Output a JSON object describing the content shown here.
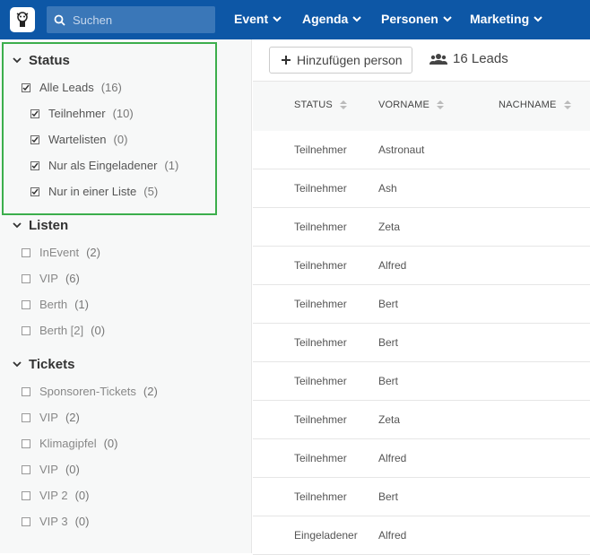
{
  "header": {
    "search_placeholder": "Suchen",
    "nav": [
      {
        "label": "Event"
      },
      {
        "label": "Agenda"
      },
      {
        "label": "Personen"
      },
      {
        "label": "Marketing"
      }
    ],
    "brand_color": "#0d57a6"
  },
  "sidebar": {
    "status": {
      "title": "Status",
      "items": [
        {
          "label": "Alle Leads",
          "count": "(16)",
          "checked": true
        },
        {
          "label": "Teilnehmer",
          "count": "(10)",
          "checked": true
        },
        {
          "label": "Wartelisten",
          "count": "(0)",
          "checked": true
        },
        {
          "label": "Nur als Eingeladener",
          "count": "(1)",
          "checked": true
        },
        {
          "label": "Nur in einer Liste",
          "count": "(5)",
          "checked": true
        }
      ]
    },
    "listen": {
      "title": "Listen",
      "items": [
        {
          "label": "InEvent",
          "count": "(2)",
          "checked": false
        },
        {
          "label": "VIP",
          "count": "(6)",
          "checked": false
        },
        {
          "label": "Berth",
          "count": "(1)",
          "checked": false
        },
        {
          "label": "Berth [2]",
          "count": "(0)",
          "checked": false
        }
      ]
    },
    "tickets": {
      "title": "Tickets",
      "items": [
        {
          "label": "Sponsoren-Tickets",
          "count": "(2)",
          "checked": false
        },
        {
          "label": "VIP",
          "count": "(2)",
          "checked": false
        },
        {
          "label": "Klimagipfel",
          "count": "(0)",
          "checked": false
        },
        {
          "label": "VIP",
          "count": "(0)",
          "checked": false
        },
        {
          "label": "VIP 2",
          "count": "(0)",
          "checked": false
        },
        {
          "label": "VIP 3",
          "count": "(0)",
          "checked": false
        }
      ]
    },
    "highlight_color": "#3cae4c"
  },
  "main": {
    "add_button_label": "Hinzufügen person",
    "leads_count_label": "16 Leads",
    "columns": [
      "STATUS",
      "VORNAME",
      "NACHNAME"
    ],
    "rows": [
      {
        "status": "Teilnehmer",
        "vorname": "Astronaut"
      },
      {
        "status": "Teilnehmer",
        "vorname": "Ash"
      },
      {
        "status": "Teilnehmer",
        "vorname": "Zeta"
      },
      {
        "status": "Teilnehmer",
        "vorname": "Alfred"
      },
      {
        "status": "Teilnehmer",
        "vorname": "Bert"
      },
      {
        "status": "Teilnehmer",
        "vorname": "Bert"
      },
      {
        "status": "Teilnehmer",
        "vorname": "Bert"
      },
      {
        "status": "Teilnehmer",
        "vorname": "Zeta"
      },
      {
        "status": "Teilnehmer",
        "vorname": "Alfred"
      },
      {
        "status": "Teilnehmer",
        "vorname": "Bert"
      },
      {
        "status": "Eingeladener",
        "vorname": "Alfred"
      }
    ]
  }
}
